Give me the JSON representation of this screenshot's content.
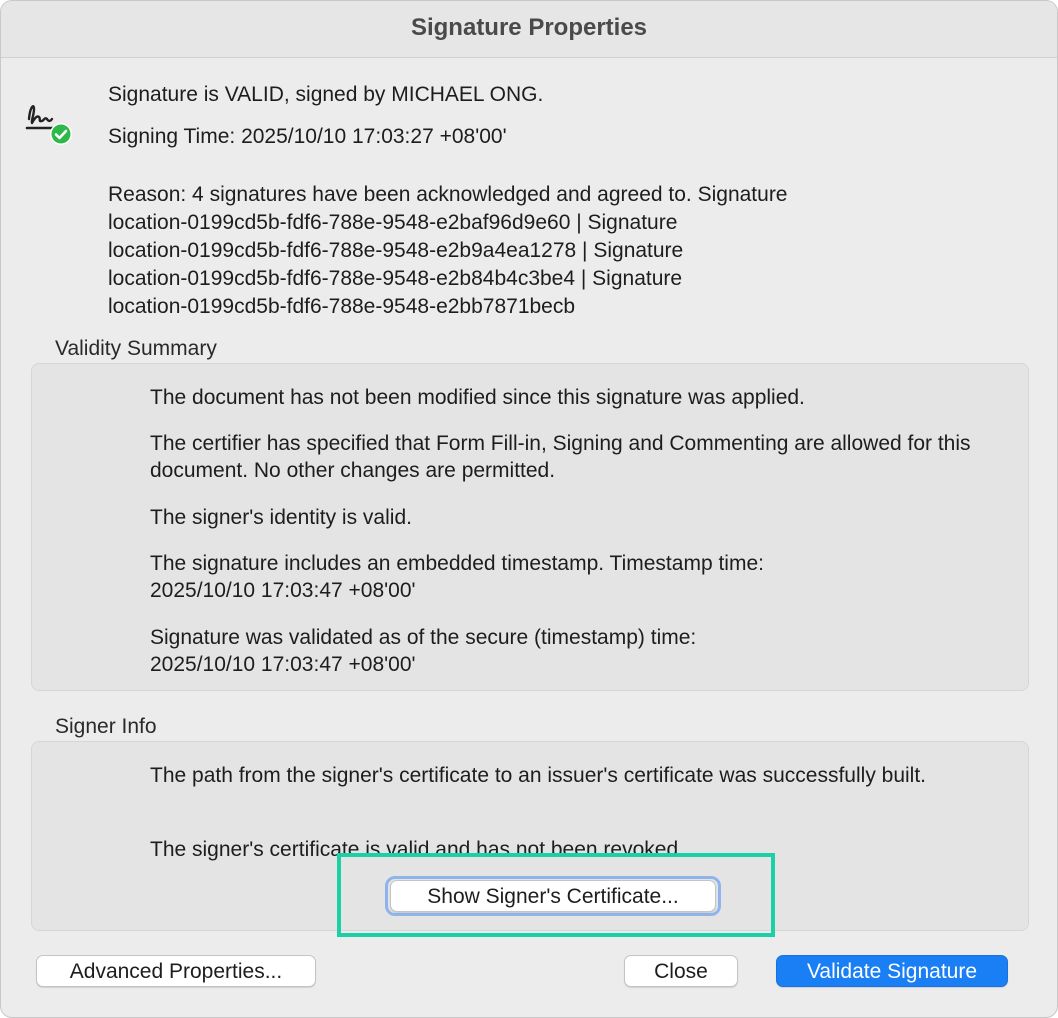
{
  "window": {
    "title": "Signature Properties"
  },
  "header": {
    "icon": "signature-valid-icon",
    "status_line": "Signature is VALID, signed by MICHAEL ONG.",
    "signing_time": "Signing Time:  2025/10/10 17:03:27 +08'00'",
    "reason_lines": [
      "Reason:  4 signatures have been acknowledged and agreed to. Signature",
      "location-0199cd5b-fdf6-788e-9548-e2baf96d9e60 | Signature",
      "location-0199cd5b-fdf6-788e-9548-e2b9a4ea1278 | Signature",
      "location-0199cd5b-fdf6-788e-9548-e2b84b4c3be4 | Signature",
      "location-0199cd5b-fdf6-788e-9548-e2bb7871becb"
    ]
  },
  "validity_summary": {
    "label": "Validity Summary",
    "items": [
      "The document has not been modified since this signature was applied.",
      "The certifier has specified that Form Fill-in, Signing and Commenting are allowed for this document. No other changes are permitted.",
      "The signer's identity is valid.",
      "The signature includes an embedded timestamp. Timestamp time: 2025/10/10 17:03:47 +08'00'",
      "Signature was validated as of the secure (timestamp) time: 2025/10/10 17:03:47 +08'00'"
    ]
  },
  "signer_info": {
    "label": "Signer Info",
    "items": [
      "The path from the signer's certificate to an issuer's certificate was successfully built.",
      "The signer's certificate is valid and has not been revoked."
    ],
    "show_certificate_label": "Show Signer's Certificate..."
  },
  "footer": {
    "advanced_label": "Advanced Properties...",
    "close_label": "Close",
    "validate_label": "Validate Signature"
  },
  "colors": {
    "primary_button": "#1a7ff5",
    "highlight": "#1dcfa5",
    "valid_check": "#2fb84a"
  }
}
